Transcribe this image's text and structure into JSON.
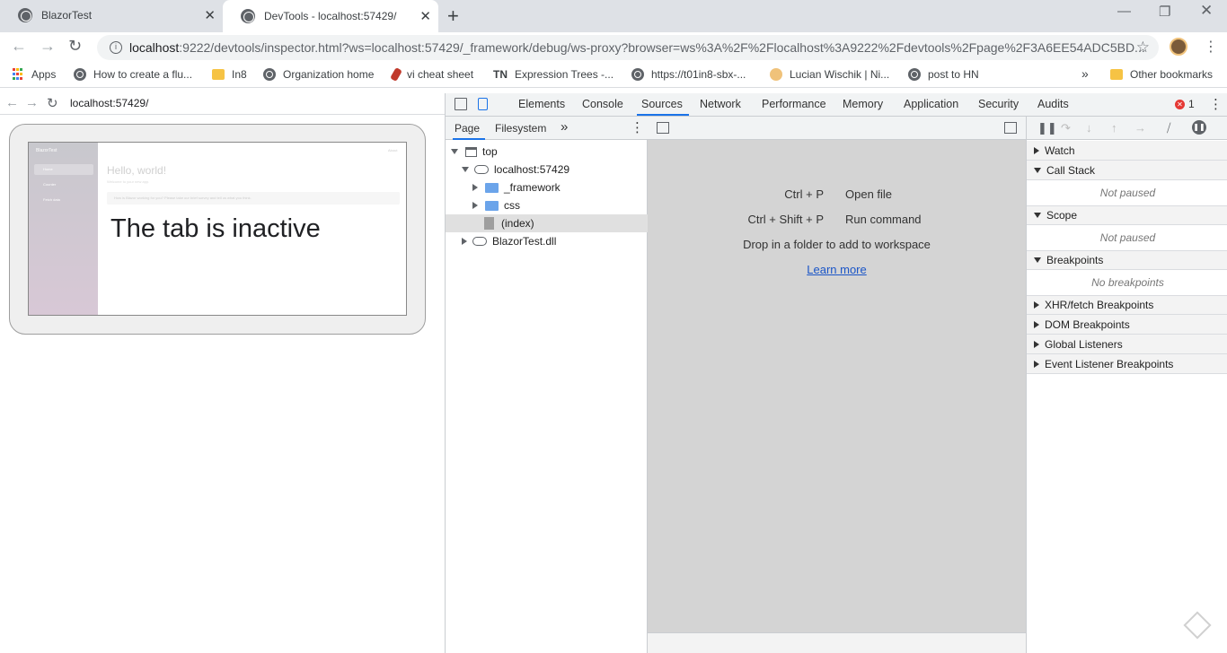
{
  "browser": {
    "tabs": [
      {
        "title": "BlazorTest",
        "active": false
      },
      {
        "title": "DevTools - localhost:57429/",
        "active": true
      }
    ],
    "address": {
      "host": "localhost",
      "path": ":9222/devtools/inspector.html?ws=localhost:57429/_framework/debug/ws-proxy?browser=ws%3A%2F%2Flocalhost%3A9222%2Fdevtools%2Fpage%2F3A6EE54ADC5BD..."
    },
    "bookmarks": [
      {
        "label": "Apps",
        "icon": "apps-grid-icon"
      },
      {
        "label": "How to create a flu...",
        "icon": "globe-icon"
      },
      {
        "label": "In8",
        "icon": "folder-icon"
      },
      {
        "label": "Organization home",
        "icon": "globe-icon"
      },
      {
        "label": "vi cheat sheet",
        "icon": "pen-icon"
      },
      {
        "label": "Expression Trees -...",
        "icon": "tn-icon",
        "prefix": "TN"
      },
      {
        "label": "https://t01in8-sbx-...",
        "icon": "globe-icon"
      },
      {
        "label": "Lucian Wischik | Ni...",
        "icon": "person-icon"
      },
      {
        "label": "post to HN",
        "icon": "globe-icon"
      }
    ],
    "more_bookmarks": "»",
    "other_bookmarks": "Other bookmarks"
  },
  "viewport": {
    "url": "localhost:57429/",
    "screencast": {
      "brand": "BlazorTest",
      "nav": [
        "Home",
        "Counter",
        "Fetch data"
      ],
      "about": "About",
      "heading": "Hello, world!",
      "welcome": "Welcome to your new app.",
      "survey": "How is Blazor working for you? Please take our brief survey and tell us what you think."
    },
    "overlay": "The tab is inactive"
  },
  "devtools": {
    "tabs": [
      "Elements",
      "Console",
      "Sources",
      "Network",
      "Performance",
      "Memory",
      "Application",
      "Security",
      "Audits"
    ],
    "active_tab": "Sources",
    "error_count": "1",
    "navigator": {
      "tabs": [
        "Page",
        "Filesystem"
      ],
      "more": "»",
      "tree": [
        {
          "label": "top",
          "depth": 0,
          "kind": "frame",
          "expanded": true
        },
        {
          "label": "localhost:57429",
          "depth": 1,
          "kind": "cloud",
          "expanded": true
        },
        {
          "label": "_framework",
          "depth": 2,
          "kind": "folder",
          "expanded": false
        },
        {
          "label": "css",
          "depth": 2,
          "kind": "folder",
          "expanded": false
        },
        {
          "label": "(index)",
          "depth": 2,
          "kind": "file",
          "selected": true
        },
        {
          "label": "BlazorTest.dll",
          "depth": 1,
          "kind": "cloud",
          "expanded": false
        }
      ]
    },
    "editor": {
      "shortcuts": [
        {
          "keys": "Ctrl + P",
          "desc": "Open file"
        },
        {
          "keys": "Ctrl + Shift + P",
          "desc": "Run command"
        }
      ],
      "drop": "Drop in a folder to add to workspace",
      "learn_more": "Learn more"
    },
    "debugger": {
      "sections": [
        {
          "label": "Watch",
          "expanded": false
        },
        {
          "label": "Call Stack",
          "expanded": true,
          "empty": "Not paused"
        },
        {
          "label": "Scope",
          "expanded": true,
          "empty": "Not paused"
        },
        {
          "label": "Breakpoints",
          "expanded": true,
          "empty": "No breakpoints"
        },
        {
          "label": "XHR/fetch Breakpoints",
          "expanded": false
        },
        {
          "label": "DOM Breakpoints",
          "expanded": false
        },
        {
          "label": "Global Listeners",
          "expanded": false
        },
        {
          "label": "Event Listener Breakpoints",
          "expanded": false
        }
      ]
    }
  }
}
